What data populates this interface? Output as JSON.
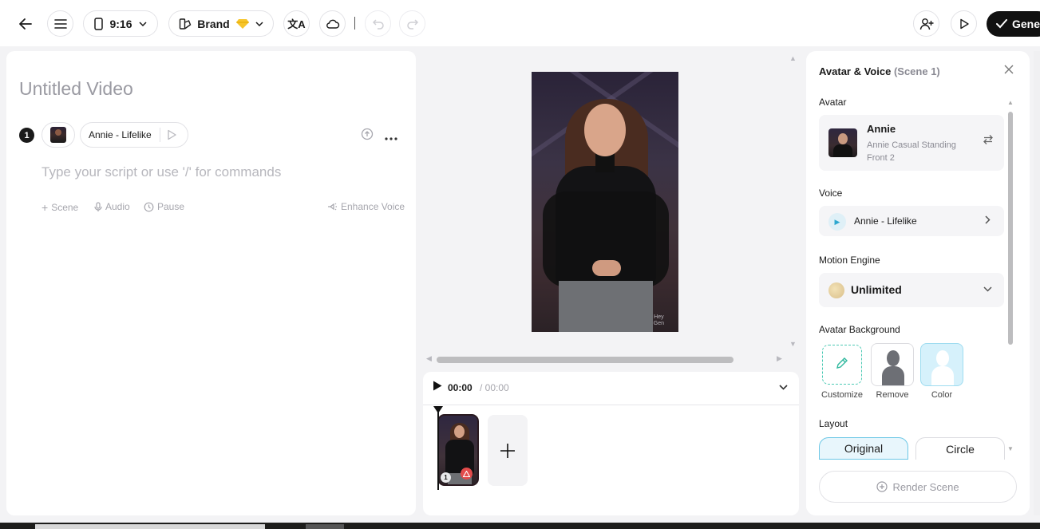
{
  "topbar": {
    "aspect_ratio": "9:16",
    "brand_label": "Brand",
    "brand_icon": "gem-icon",
    "generate_label": "Gene"
  },
  "script": {
    "title": "Untitled Video",
    "scene_number": "1",
    "voice_chip": "Annie - Lifelike",
    "placeholder": "Type your script or use '/' for commands",
    "tools": {
      "scene": "Scene",
      "audio": "Audio",
      "pause": "Pause",
      "enhance": "Enhance Voice"
    }
  },
  "preview": {
    "watermark_line1": "Hey",
    "watermark_line2": "Gen"
  },
  "timeline": {
    "current_time": "00:00",
    "total_time": "/ 00:00",
    "clip_number": "1"
  },
  "panel": {
    "title": "Avatar & Voice",
    "scene_tag": "(Scene 1)",
    "avatar_label": "Avatar",
    "avatar_name": "Annie",
    "avatar_desc": "Annie Casual Standing Front 2",
    "voice_label": "Voice",
    "voice_name": "Annie - Lifelike",
    "motion_label": "Motion Engine",
    "motion_value": "Unlimited",
    "bg_label": "Avatar Background",
    "bg_options": [
      "Customize",
      "Remove",
      "Color"
    ],
    "layout_label": "Layout",
    "layout_options": [
      "Original",
      "Circle"
    ],
    "render_label": "Render Scene"
  },
  "colors": {
    "accent_teal": "#2fb89d",
    "accent_blue": "#6cc7e6",
    "primary_dark": "#111111"
  }
}
